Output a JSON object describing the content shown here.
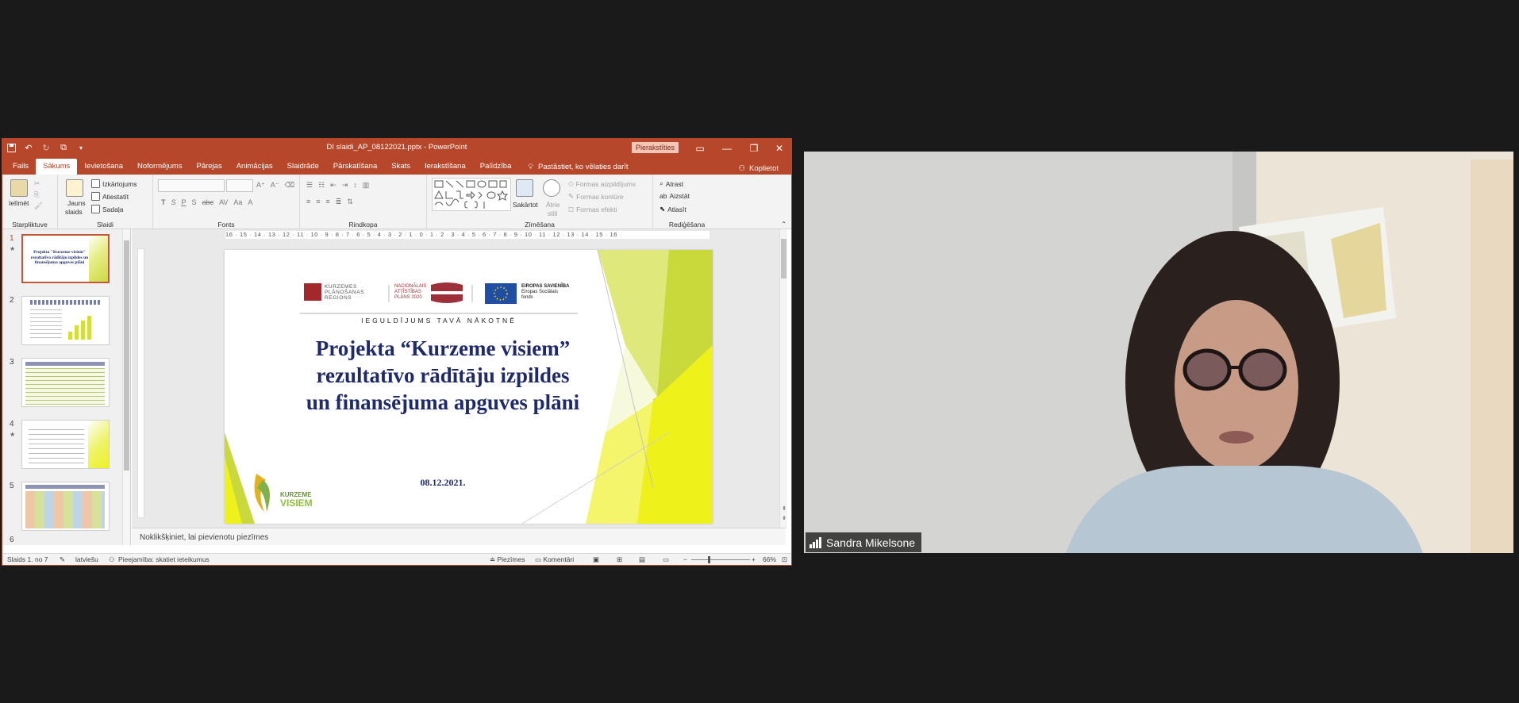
{
  "window": {
    "title": "DI slaidi_AP_08122021.pptx  -  PowerPoint",
    "sign_in": "Pierakstīties"
  },
  "tabs": [
    "Fails",
    "Sākums",
    "Ievietošana",
    "Noformējums",
    "Pārejas",
    "Animācijas",
    "Slaidrāde",
    "Pārskatīšana",
    "Skats",
    "Ierakstīšana",
    "Palīdzība"
  ],
  "active_tab": "Sākums",
  "tell_me": "Pastāstiet, ko vēlaties darīt",
  "share": "Koplietot",
  "ribbon": {
    "clipboard": {
      "paste": "Ielīmēt",
      "label": "Starpliktuve"
    },
    "slides": {
      "new_slide_1": "Jauns",
      "new_slide_2": "slaids",
      "layout": "Izkārtojums",
      "reset": "Atiestatīt",
      "section": "Sadaļa",
      "label": "Slaidi"
    },
    "font": {
      "label": "Fonts"
    },
    "paragraph": {
      "label": "Rindkopa"
    },
    "drawing": {
      "arrange": "Sakārtot",
      "quick_styles_1": "Ātrie",
      "quick_styles_2": "stili",
      "shape_fill": "Formas aizpildījums",
      "shape_outline": "Formas kontūre",
      "shape_effects": "Formas efekti",
      "label": "Zīmēšana"
    },
    "editing": {
      "find": "Atrast",
      "replace": "Aizstāt",
      "select": "Atlasīt",
      "label": "Rediģēšana"
    }
  },
  "thumbnails": [
    {
      "num": "1",
      "star": "★",
      "title": "Projekta \"Kurzeme visiem\" rezultatīvo rādītāju izpildes un finansējuma apguves plāni"
    },
    {
      "num": "2",
      "star": "",
      "title": ""
    },
    {
      "num": "3",
      "star": "",
      "title": ""
    },
    {
      "num": "4",
      "star": "★",
      "title": ""
    },
    {
      "num": "5",
      "star": "",
      "title": ""
    },
    {
      "num": "6",
      "star": "",
      "title": ""
    }
  ],
  "ruler": "16 · 15 · 14 · 13 · 12 · 11 · 10 · 9 · 8 · 7 · 6 · 5 · 4 · 3 · 2 · 1 · 0 · 1 · 2 · 3 · 4 · 5 · 6 · 7 · 8 · 9 · 10 · 11 · 12 · 13 · 14 · 15 · 16",
  "slide": {
    "logo_region_1": "KURZEMES",
    "logo_region_2": "PLĀNOŠANAS",
    "logo_region_3": "REGIONS",
    "logo_nap_1": "NACIONĀLAIS",
    "logo_nap_2": "ATTĪSTĪBAS",
    "logo_nap_3": "PLĀNS 2020",
    "logo_eu_1": "EIROPAS SAVIENĪBA",
    "logo_eu_2": "Eiropas Sociālais",
    "logo_eu_3": "fonds",
    "tagline": "IEGULDĪJUMS TAVĀ NĀKOTNĒ",
    "title_line1": "Projekta “Kurzeme visiem”",
    "title_line2": "rezultatīvo rādītāju izpildes",
    "title_line3": "un finansējuma apguves plāni",
    "date": "08.12.2021.",
    "brand_1": "KURZEME",
    "brand_2": "VISIEM"
  },
  "notes_placeholder": "Noklikšķiniet, lai pievienotu piezīmes",
  "status": {
    "slide_count": "Slaids 1. no 7",
    "language": "latviešu",
    "accessibility": "Pieejamība: skatiet ieteikumus",
    "notes": "Piezīmes",
    "comments": "Komentāri",
    "zoom": "66%"
  },
  "participant": {
    "name": "Sandra Mikelsone"
  },
  "colors": {
    "accent": "#b7472a",
    "slide_title": "#1f2a6b",
    "slide_green": "#c9d83a"
  }
}
